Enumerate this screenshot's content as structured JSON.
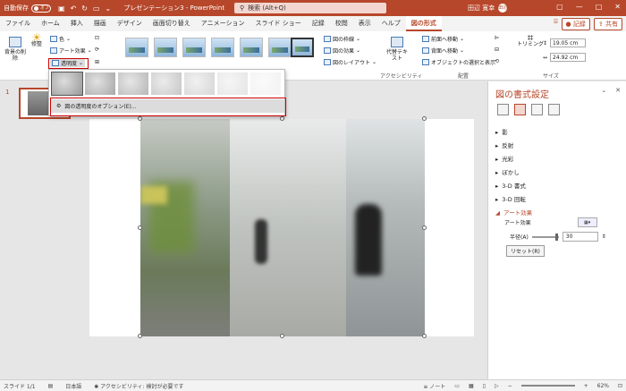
{
  "titlebar": {
    "autosave_label": "自動保存",
    "autosave_state": "オフ",
    "doc_title": "プレゼンテーション3 - PowerPoint",
    "search_placeholder": "検索 (Alt+Q)",
    "user_name": "田辺 寛幸",
    "user_initials": "田辺"
  },
  "tabs": [
    "ファイル",
    "ホーム",
    "挿入",
    "描画",
    "デザイン",
    "画面切り替え",
    "アニメーション",
    "スライド ショー",
    "記録",
    "校閲",
    "表示",
    "ヘルプ",
    "図の形式"
  ],
  "tabs_right": {
    "record": "記録",
    "share": "共有"
  },
  "ribbon": {
    "remove_bg": "背景の削除",
    "corrections": "修整",
    "color": "色",
    "art_effects": "アート効果",
    "transparency": "透明度",
    "border": "図の枠線",
    "effects": "図の効果",
    "layout": "図のレイアウト",
    "alt_text": "代替テキスト",
    "accessibility": "アクセシビリティ",
    "bring_forward": "前面へ移動",
    "send_backward": "背面へ移動",
    "selection_pane": "オブジェクトの選択と表示",
    "arrange": "配置",
    "crop": "トリミング",
    "height": "19.05 cm",
    "width": "24.92 cm",
    "size": "サイズ"
  },
  "dropdown": {
    "option": "図の透明度のオプション(E)..."
  },
  "slide_panel": {
    "number": "1"
  },
  "format_pane": {
    "title": "図の書式設定",
    "sections": [
      {
        "label": "影",
        "open": false
      },
      {
        "label": "反射",
        "open": false
      },
      {
        "label": "光彩",
        "open": false
      },
      {
        "label": "ぼかし",
        "open": false
      },
      {
        "label": "3-D 書式",
        "open": false
      },
      {
        "label": "3-D 回転",
        "open": false
      },
      {
        "label": "アート効果",
        "open": true
      }
    ],
    "art_effect_label": "アート効果",
    "radius_label": "半径(A)",
    "radius_value": "30",
    "reset_label": "リセット(R)"
  },
  "statusbar": {
    "slide": "スライド 1/1",
    "lang": "日本語",
    "accessibility": "アクセシビリティ: 検討が必要です",
    "notes": "ノート",
    "zoom": "62%"
  }
}
